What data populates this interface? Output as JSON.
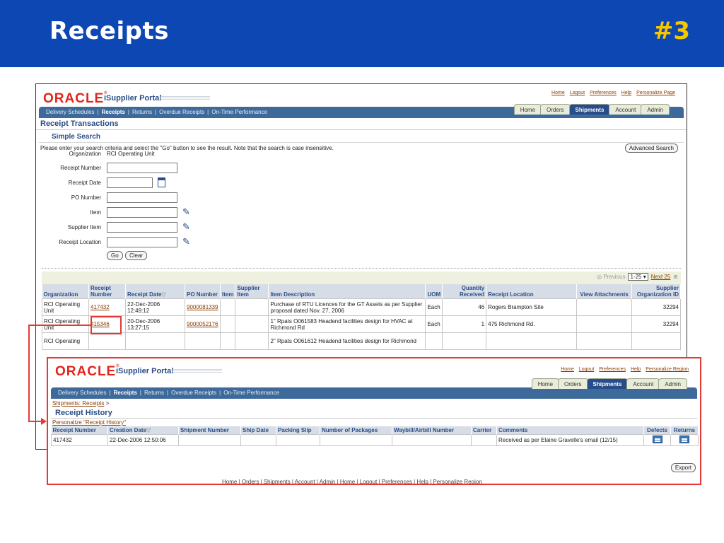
{
  "slide": {
    "title": "Receipts",
    "number": "#3"
  },
  "portal": {
    "logo": "ORACLE",
    "name": "iSupplier Portal",
    "global_links": [
      "Home",
      "Logout",
      "Preferences",
      "Help",
      "Personalize Page"
    ],
    "tabs": [
      "Home",
      "Orders",
      "Shipments",
      "Account",
      "Admin"
    ],
    "active_tab": "Shipments",
    "subnav": [
      "Delivery Schedules",
      "Receipts",
      "Returns",
      "Overdue Receipts",
      "On-Time Performance"
    ],
    "active_subnav": "Receipts"
  },
  "receipt_transactions": {
    "title": "Receipt Transactions",
    "simple_search": "Simple Search",
    "instructions": "Please enter your search criteria and select the \"Go\" button to see the result. Note that the search is case insensitive.",
    "advanced_search": "Advanced Search",
    "fields": {
      "organization_label": "Organization",
      "organization_value": "RCI Operating Unit",
      "receipt_number_label": "Receipt Number",
      "receipt_date_label": "Receipt Date",
      "po_number_label": "PO Number",
      "item_label": "Item",
      "supplier_item_label": "Supplier Item",
      "receipt_location_label": "Receipt Location"
    },
    "go": "Go",
    "clear": "Clear",
    "pager": {
      "previous": "Previous",
      "range": "1-25",
      "next": "Next 25"
    },
    "columns": [
      "Organization",
      "Receipt Number",
      "Receipt Date",
      "PO Number",
      "Item",
      "Supplier Item",
      "Item Description",
      "UOM",
      "Quantity Received",
      "Receipt Location",
      "View Attachments",
      "Supplier Organization ID"
    ],
    "rows": [
      {
        "org": "RCI Operating Unit",
        "receipt": "417432",
        "date": "22-Dec-2006 12:49:12",
        "po": "9000081339",
        "item": "",
        "supplier_item": "",
        "desc": "Purchase of RTU Licences for the GT Assets as per Supplier  proposal dated Nov. 27, 2006",
        "uom": "Each",
        "qty": "46",
        "location": "Rogers Brampton Site",
        "attach": "",
        "supplier_org": "32294"
      },
      {
        "org": "RCI Operating Unit",
        "receipt": "415346",
        "date": "20-Dec-2006 13:27:15",
        "po": "9000052176",
        "item": "",
        "supplier_item": "",
        "desc": "1\" Rpats O061583 Headend facilities design for HVAC at Richmond Rd",
        "uom": "Each",
        "qty": "1",
        "location": "475 Richmond Rd.",
        "attach": "",
        "supplier_org": "32294"
      },
      {
        "org": "RCI Operating",
        "receipt": "",
        "date": "",
        "po": "",
        "item": "",
        "supplier_item": "",
        "desc": "2\" Rpats O061612 Headend facilities design for Richmond",
        "uom": "",
        "qty": "",
        "location": "",
        "attach": "",
        "supplier_org": ""
      }
    ]
  },
  "receipt_history": {
    "global_links": [
      "Home",
      "Logout",
      "Preferences",
      "Help",
      "Personalize Region"
    ],
    "breadcrumb": "Shipments: Receipts",
    "breadcrumb_sep": ">",
    "title": "Receipt History",
    "personalize": "Personalize \"Receipt History\"",
    "columns": [
      "Receipt Number",
      "Creation Date",
      "Shipment Number",
      "Ship Date",
      "Packing Slip",
      "Number of Packages",
      "Waybill/Airbill Number",
      "Carrier",
      "Comments",
      "Defects",
      "Returns"
    ],
    "row": {
      "receipt_number": "417432",
      "creation_date": "22-Dec-2006 12:50:06",
      "shipment_number": "",
      "ship_date": "",
      "packing_slip": "",
      "packages": "",
      "waybill": "",
      "carrier": "",
      "comments": "Received as per Elaine Gravelle's email (12/15)"
    },
    "export": "Export",
    "footer": "Home  |  Orders  |  Shipments  |  Account  |  Admin  |  Home  |  Logout  |  Preferences  |  Help  |  Personalize Region"
  },
  "colors": {
    "slide_blue": "#0d47b4",
    "slide_accent": "#f6c600",
    "highlight": "#e53935",
    "oracle_red": "#e1251b",
    "nav_blue": "#3d6a9a"
  }
}
